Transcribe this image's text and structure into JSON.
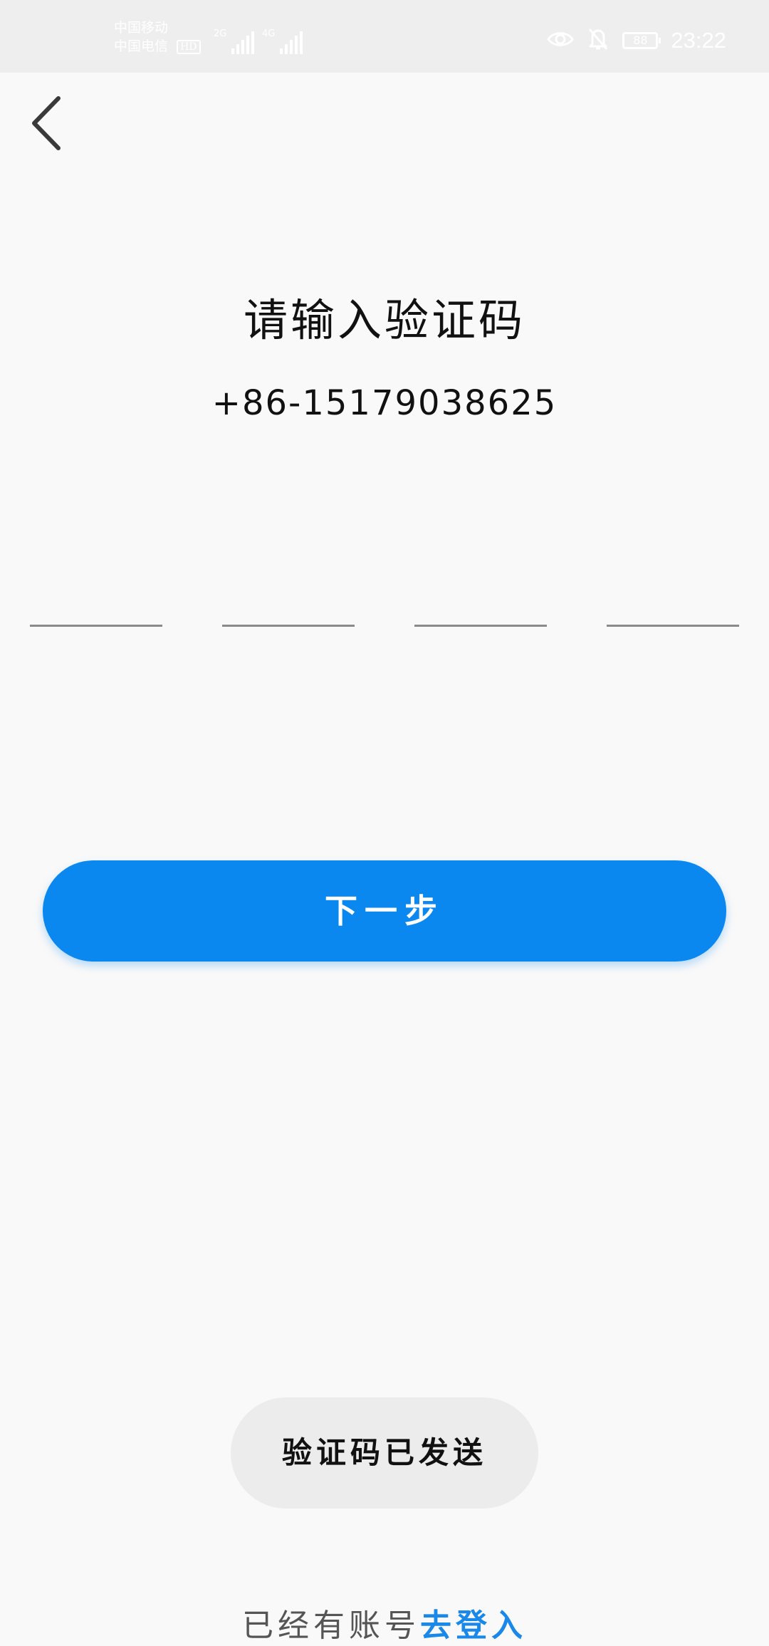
{
  "status_bar": {
    "carrier_1": "中国移动",
    "carrier_2": "中国电信",
    "hd_badge": "HD",
    "network_1": "2G",
    "network_2": "4G",
    "battery_level": "88",
    "time": "23:22",
    "icons": [
      "eye-icon",
      "bell-off-icon",
      "battery-icon"
    ]
  },
  "header": {
    "back_icon": "chevron-left-icon"
  },
  "main": {
    "title": "请输入验证码",
    "phone": "+86-15179038625",
    "code_inputs": [
      "",
      "",
      "",
      ""
    ],
    "next_button": "下一步"
  },
  "toast": {
    "message": "验证码已发送"
  },
  "footer": {
    "prompt": "已经有账号",
    "login_link": "去登入"
  },
  "colors": {
    "accent": "#0a88f0",
    "link": "#1a88e8",
    "background": "#f9f9f9",
    "status_bar": "#eeeeee"
  }
}
